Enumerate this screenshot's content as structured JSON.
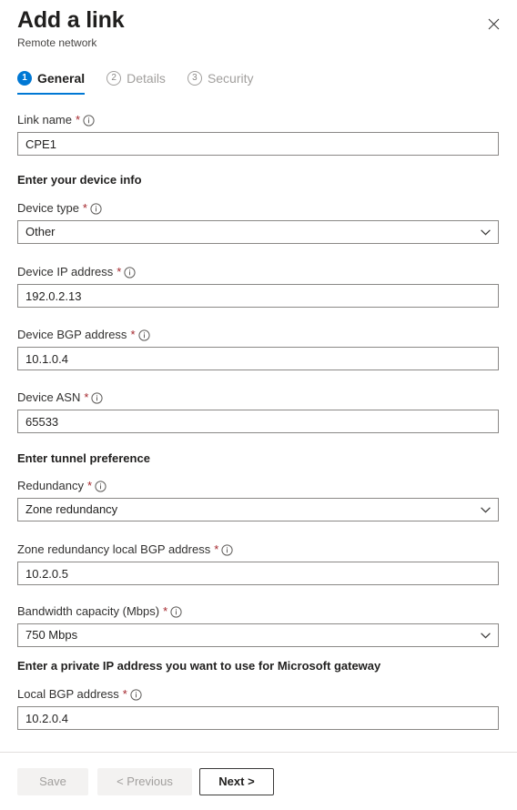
{
  "header": {
    "title": "Add a link",
    "subtitle": "Remote network",
    "close_icon": "close-icon"
  },
  "tabs": [
    {
      "num": "1",
      "label": "General",
      "state": "active"
    },
    {
      "num": "2",
      "label": "Details",
      "state": "inactive"
    },
    {
      "num": "3",
      "label": "Security",
      "state": "inactive"
    }
  ],
  "form": {
    "link_name": {
      "label": "Link name",
      "required": "*",
      "info_icon": "info-icon",
      "value": "CPE1"
    },
    "section_device": "Enter your device info",
    "device_type": {
      "label": "Device type",
      "required": "*",
      "info_icon": "info-icon",
      "value": "Other",
      "chevron_icon": "chevron-down-icon"
    },
    "device_ip": {
      "label": "Device IP address",
      "required": "*",
      "info_icon": "info-icon",
      "value": "192.0.2.13"
    },
    "device_bgp": {
      "label": "Device BGP address",
      "required": "*",
      "info_icon": "info-icon",
      "value": "10.1.0.4"
    },
    "device_asn": {
      "label": "Device ASN",
      "required": "*",
      "info_icon": "info-icon",
      "value": "65533"
    },
    "section_tunnel": "Enter tunnel preference",
    "redundancy": {
      "label": "Redundancy",
      "required": "*",
      "info_icon": "info-icon",
      "value": "Zone redundancy",
      "chevron_icon": "chevron-down-icon"
    },
    "zone_local_bgp": {
      "label": "Zone redundancy local BGP address",
      "required": "*",
      "info_icon": "info-icon",
      "value": "10.2.0.5"
    },
    "bandwidth": {
      "label": "Bandwidth capacity (Mbps)",
      "required": "*",
      "info_icon": "info-icon",
      "value": "750 Mbps",
      "chevron_icon": "chevron-down-icon"
    },
    "section_gateway": "Enter a private IP address you want to use for Microsoft gateway",
    "local_bgp": {
      "label": "Local BGP address",
      "required": "*",
      "info_icon": "info-icon",
      "value": "10.2.0.4"
    }
  },
  "footer": {
    "save_label": "Save",
    "previous_label": "< Previous",
    "next_label": "Next >"
  },
  "colors": {
    "accent": "#0078d4",
    "required_asterisk": "#a4262c",
    "border": "#8a8886",
    "disabled_bg": "#f3f2f1",
    "disabled_text": "#a19f9d",
    "divider": "#e1dfdd"
  }
}
